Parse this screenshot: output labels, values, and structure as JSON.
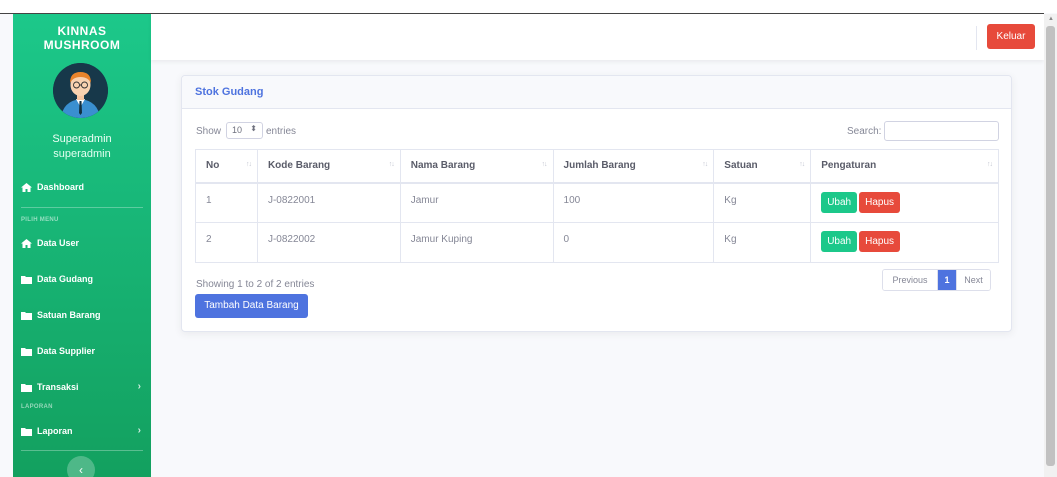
{
  "brand": {
    "line1": "KINNAS",
    "line2": "MUSHROOM"
  },
  "user": {
    "name": "Superadmin",
    "role": "superadmin"
  },
  "sidebar": {
    "dashboard": "Dashboard",
    "heading_menu": "PILIH MENU",
    "items": [
      "Data User",
      "Data Gudang",
      "Satuan Barang",
      "Data Supplier",
      "Transaksi"
    ],
    "heading_report": "LAPORAN",
    "report": "Laporan"
  },
  "topbar": {
    "logout": "Keluar"
  },
  "card": {
    "title": "Stok Gudang"
  },
  "datatable": {
    "show": "Show",
    "length": "10",
    "entries": "entries",
    "search": "Search:",
    "columns": [
      "No",
      "Kode Barang",
      "Nama Barang",
      "Jumlah Barang",
      "Satuan",
      "Pengaturan"
    ],
    "rows": [
      [
        "1",
        "J-0822001",
        "Jamur",
        "100",
        "Kg"
      ],
      [
        "2",
        "J-0822002",
        "Jamur Kuping",
        "0",
        "Kg"
      ]
    ],
    "edit_label": "Ubah",
    "delete_label": "Hapus",
    "info": "Showing 1 to 2 of 2 entries",
    "pager": {
      "prev": "Previous",
      "current": "1",
      "next": "Next"
    }
  },
  "add_button": "Tambah Data Barang",
  "colors": {
    "sidebar": "#1cc88a",
    "primary": "#4e73df",
    "danger": "#e74a3b",
    "success": "#1cc88a"
  }
}
